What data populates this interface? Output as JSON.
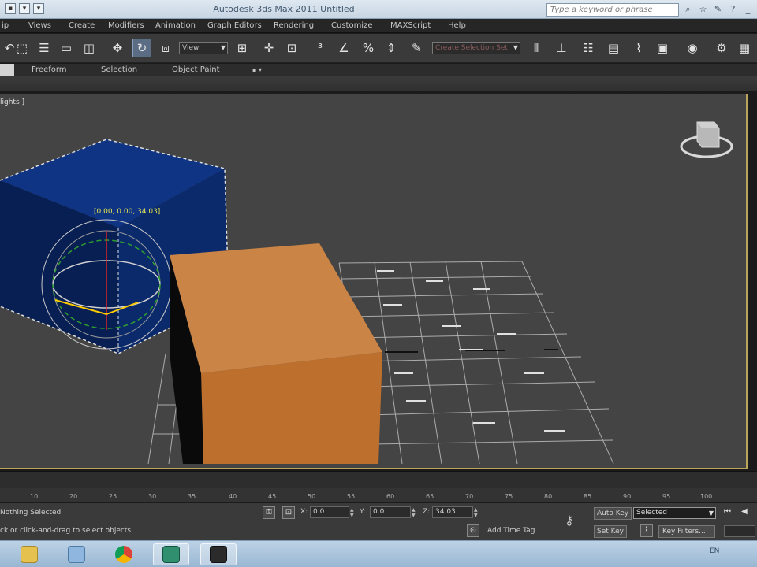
{
  "window": {
    "title": "Autodesk 3ds Max  2011    Untitled",
    "search_placeholder": "Type a keyword or phrase"
  },
  "menubar": [
    "ip",
    "Views",
    "Create",
    "Modifiers",
    "Animation",
    "Graph Editors",
    "Rendering",
    "Customize",
    "MAXScript",
    "Help"
  ],
  "toolbar": {
    "selection_filter": "View",
    "named_selection": "Create Selection Set"
  },
  "ribbon_tabs": [
    "Freeform",
    "Selection",
    "Object Paint"
  ],
  "viewport": {
    "label": "lights ]",
    "gizmo_readout": "[0.00,  0.00,  34.03]",
    "colors": {
      "background": "#444444",
      "blue_box": "#0d2a6e",
      "orange_box": "#c77d3e",
      "grid": "#cfcfcf",
      "active_border": "#b9a45c"
    }
  },
  "timeline": {
    "ticks": [
      "10",
      "20",
      "25",
      "30",
      "35",
      "40",
      "45",
      "50",
      "55",
      "60",
      "65",
      "70",
      "75",
      "80",
      "85",
      "90",
      "95",
      "100"
    ]
  },
  "status": {
    "selection_info": "Nothing Selected",
    "prompt": "ck or click-and-drag to select objects",
    "x_label": "X:",
    "x_value": "0.0",
    "y_label": "Y:",
    "y_value": "0.0",
    "z_label": "Z:",
    "z_value": "34.03",
    "add_time_tag": "Add Time Tag",
    "auto_key": "Auto Key",
    "set_key": "Set Key",
    "key_mode": "Selected",
    "key_filters": "Key Filters..."
  },
  "taskbar": {
    "apps": [
      "windows-explorer",
      "document",
      "chrome-browser",
      "3ds-max-green",
      "3ds-max-app"
    ],
    "tray_text": "EN"
  }
}
